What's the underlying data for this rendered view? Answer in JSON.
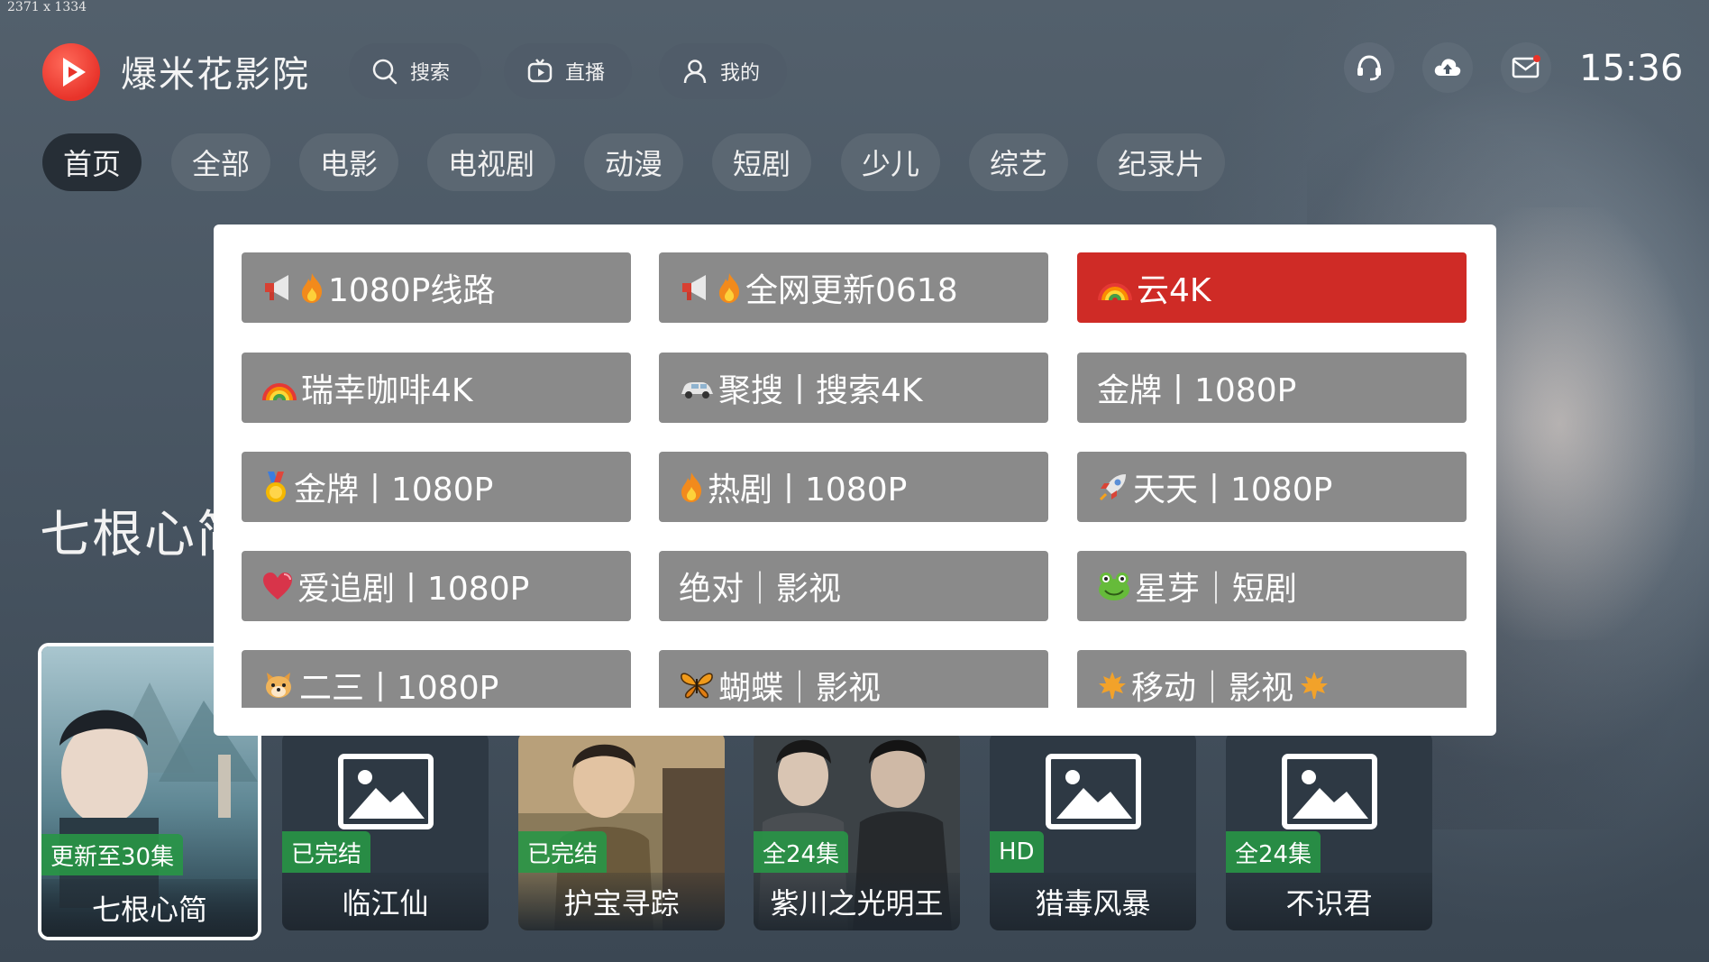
{
  "dimension_label": "2371 x 1334",
  "app": {
    "title": "爆米花影院",
    "logo_icon": "play-logo-icon"
  },
  "header": {
    "search_label": "搜索",
    "live_label": "直播",
    "mine_label": "我的",
    "clock": "15:36"
  },
  "tabs": [
    {
      "label": "首页",
      "active": true
    },
    {
      "label": "全部"
    },
    {
      "label": "电影"
    },
    {
      "label": "电视剧"
    },
    {
      "label": "动漫"
    },
    {
      "label": "短剧"
    },
    {
      "label": "少儿"
    },
    {
      "label": "综艺"
    },
    {
      "label": "纪录片"
    }
  ],
  "hero": {
    "title": "七根心简"
  },
  "cards": [
    {
      "badge": "更新至30集",
      "name": "七根心简",
      "featured": true
    },
    {
      "badge": "已完结",
      "name": "临江仙"
    },
    {
      "badge": "已完结",
      "name": "护宝寻踪"
    },
    {
      "badge": "全24集",
      "name": "紫川之光明王"
    },
    {
      "badge": "HD",
      "name": "猎毒风暴"
    },
    {
      "badge": "全24集",
      "name": "不识君"
    }
  ],
  "source_modal": {
    "items": [
      {
        "label": "1080P线路",
        "icons": [
          "megaphone-icon",
          "fire-icon"
        ]
      },
      {
        "label": "全网更新0618",
        "icons": [
          "megaphone-icon",
          "fire-icon"
        ]
      },
      {
        "label": "云4K",
        "icons": [
          "rainbow-icon"
        ],
        "selected": true
      },
      {
        "label": "瑞幸咖啡4K",
        "icons": [
          "rainbow-icon"
        ]
      },
      {
        "label": "聚搜丨搜索4K",
        "icons": [
          "car-icon"
        ]
      },
      {
        "label": "金牌丨1080P",
        "icons": []
      },
      {
        "label": "金牌丨1080P",
        "icons": [
          "gold-medal-icon"
        ]
      },
      {
        "label": "热剧丨1080P",
        "icons": [
          "fire-icon"
        ]
      },
      {
        "label": "天天丨1080P",
        "icons": [
          "rocket-icon"
        ]
      },
      {
        "label": "爱追剧丨1080P",
        "icons": [
          "heart-icon"
        ]
      },
      {
        "label": "绝对｜影视",
        "icons": []
      },
      {
        "label": "星芽｜短剧",
        "icons": [
          "frog-icon"
        ]
      },
      {
        "label": "二三丨1080P",
        "icons": [
          "dog-icon"
        ]
      },
      {
        "label": "蝴蝶｜影视",
        "icons": [
          "butterfly-icon"
        ]
      },
      {
        "label": "移动｜影视",
        "icons": [
          "maple-leaf-icon"
        ],
        "trailing_icon": "maple-leaf-icon"
      }
    ],
    "selected_color": "#cf2b26",
    "item_color": "#8a8a8a"
  }
}
